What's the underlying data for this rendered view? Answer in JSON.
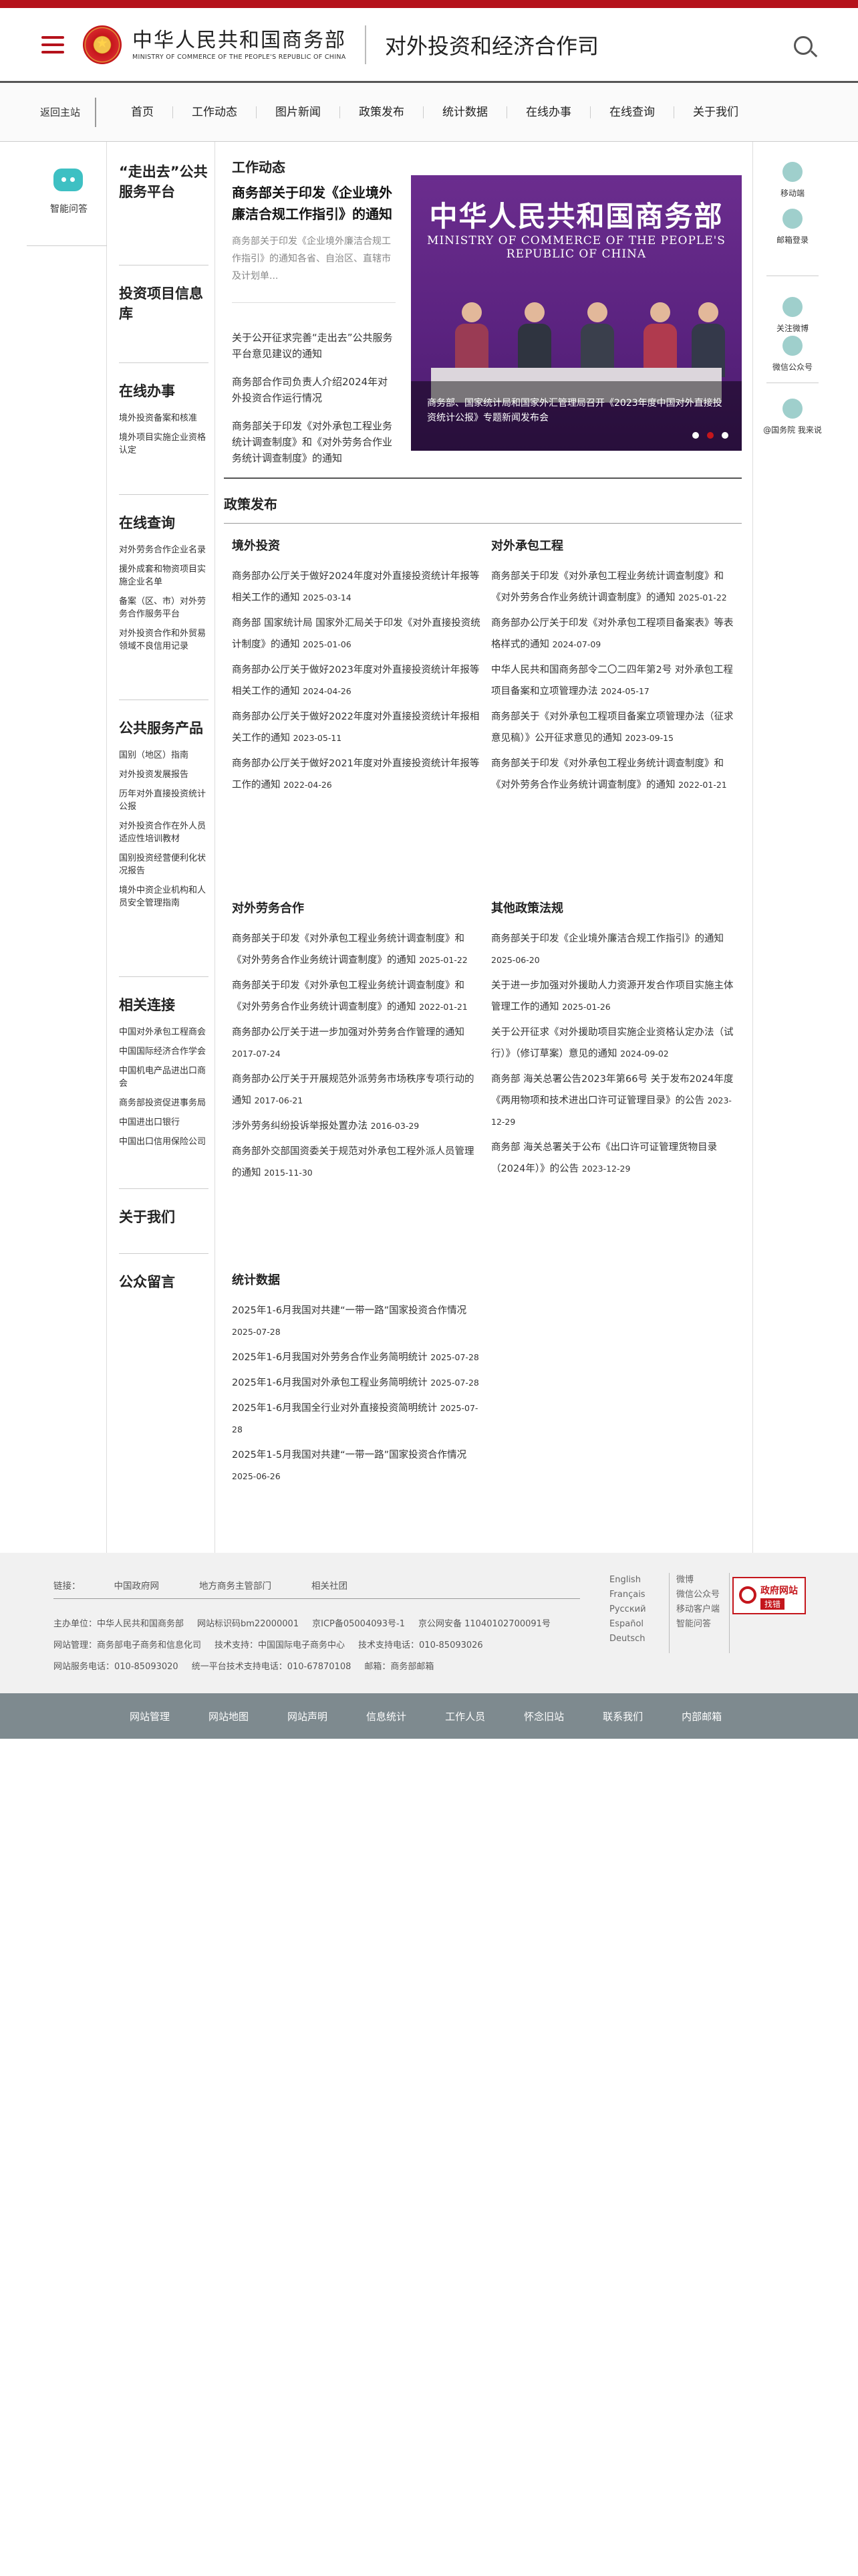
{
  "header": {
    "logo_cn": "中华人民共和国商务部",
    "logo_en": "MINISTRY OF COMMERCE OF THE PEOPLE'S REPUBLIC OF CHINA",
    "site_title": "对外投资和经济合作司"
  },
  "nav": {
    "back": "返回主站",
    "items": [
      "首页",
      "工作动态",
      "图片新闻",
      "政策发布",
      "统计数据",
      "在线办事",
      "在线查询",
      "关于我们"
    ]
  },
  "left": {
    "assistant": "智能问答"
  },
  "side": {
    "groups": [
      {
        "title": "“走出去”公共服务平台",
        "items": []
      },
      {
        "title": "投资项目信息库",
        "items": []
      },
      {
        "title": "在线办事",
        "items": [
          "境外投资备案和核准",
          "境外项目实施企业资格认定"
        ]
      },
      {
        "title": "在线查询",
        "items": [
          "对外劳务合作企业名录",
          "援外成套和物资项目实施企业名单",
          "备案（区、市）对外劳务合作服务平台",
          "对外投资合作和外贸易领域不良信用记录"
        ]
      },
      {
        "title": "公共服务产品",
        "items": [
          "国别（地区）指南",
          "对外投资发展报告",
          "历年对外直接投资统计公报",
          "对外投资合作在外人员适应性培训教材",
          "国别投资经营便利化状况报告",
          "境外中资企业机构和人员安全管理指南"
        ]
      },
      {
        "title": "相关连接",
        "items": [
          "中国对外承包工程商会",
          "中国国际经济合作学会",
          "中国机电产品进出口商会",
          "商务部投资促进事务局",
          "中国进出口银行",
          "中国出口信用保险公司"
        ]
      },
      {
        "title": "关于我们",
        "items": []
      },
      {
        "title": "公众留言",
        "items": []
      }
    ]
  },
  "news": {
    "section_title": "工作动态",
    "feature_title": "商务部关于印发《企业境外廉洁合规工作指引》的通知",
    "feature_desc": "商务部关于印发《企业境外廉洁合规工作指引》的通知各省、自治区、直辖市及计划单...",
    "list": [
      "关于公开征求完善“走出去”公共服务平台意见建议的通知",
      "商务部合作司负责人介绍2024年对外投资合作运行情况",
      "商务部关于印发《对外承包工程业务统计调查制度》和《对外劳务合作业务统计调查制度》的通知"
    ],
    "banner_cn": "中华人民共和国商务部",
    "banner_en": "MINISTRY OF COMMERCE OF THE PEOPLE'S REPUBLIC OF CHINA",
    "banner_caption": "商务部、国家统计局和国家外汇管理局召开《2023年度中国对外直接投资统计公报》专题新闻发布会"
  },
  "policy": {
    "title": "政策发布",
    "cols": [
      {
        "title": "境外投资",
        "items": [
          {
            "t": "商务部办公厅关于做好2024年度对外直接投资统计年报等相关工作的通知",
            "d": "2025-03-14"
          },
          {
            "t": "商务部 国家统计局 国家外汇局关于印发《对外直接投资统计制度》的通知",
            "d": "2025-01-06"
          },
          {
            "t": "商务部办公厅关于做好2023年度对外直接投资统计年报等相关工作的通知",
            "d": "2024-04-26"
          },
          {
            "t": "商务部办公厅关于做好2022年度对外直接投资统计年报相关工作的通知",
            "d": "2023-05-11"
          },
          {
            "t": "商务部办公厅关于做好2021年度对外直接投资统计年报等工作的通知",
            "d": "2022-04-26"
          }
        ]
      },
      {
        "title": "对外承包工程",
        "items": [
          {
            "t": "商务部关于印发《对外承包工程业务统计调查制度》和《对外劳务合作业务统计调查制度》的通知",
            "d": "2025-01-22"
          },
          {
            "t": "商务部办公厅关于印发《对外承包工程项目备案表》等表格样式的通知",
            "d": "2024-07-09"
          },
          {
            "t": "中华人民共和国商务部令二〇二四年第2号 对外承包工程项目备案和立项管理办法",
            "d": "2024-05-17"
          },
          {
            "t": "商务部关于《对外承包工程项目备案立项管理办法（征求意见稿）》公开征求意见的通知",
            "d": "2023-09-15"
          },
          {
            "t": "商务部关于印发《对外承包工程业务统计调查制度》和《对外劳务合作业务统计调查制度》的通知",
            "d": "2022-01-21"
          }
        ]
      },
      {
        "title": "对外劳务合作",
        "items": [
          {
            "t": "商务部关于印发《对外承包工程业务统计调查制度》和《对外劳务合作业务统计调查制度》的通知",
            "d": "2025-01-22"
          },
          {
            "t": "商务部关于印发《对外承包工程业务统计调查制度》和《对外劳务合作业务统计调查制度》的通知",
            "d": "2022-01-21"
          },
          {
            "t": "商务部办公厅关于进一步加强对外劳务合作管理的通知",
            "d": "2017-07-24"
          },
          {
            "t": "商务部办公厅关于开展规范外派劳务市场秩序专项行动的通知",
            "d": "2017-06-21"
          },
          {
            "t": "涉外劳务纠纷投诉举报处置办法",
            "d": "2016-03-29"
          },
          {
            "t": "商务部外交部国资委关于规范对外承包工程外派人员管理的通知",
            "d": "2015-11-30"
          }
        ]
      },
      {
        "title": "其他政策法规",
        "items": [
          {
            "t": "商务部关于印发《企业境外廉洁合规工作指引》的通知",
            "d": "2025-06-20"
          },
          {
            "t": "关于进一步加强对外援助人力资源开发合作项目实施主体管理工作的通知",
            "d": "2025-01-26"
          },
          {
            "t": "关于公开征求《对外援助项目实施企业资格认定办法（试行）》（修订草案）意见的通知",
            "d": "2024-09-02"
          },
          {
            "t": "商务部 海关总署公告2023年第66号 关于发布2024年度《两用物项和技术进出口许可证管理目录》的公告",
            "d": "2023-12-29"
          },
          {
            "t": "商务部 海关总署关于公布《出口许可证管理货物目录（2024年）》的公告",
            "d": "2023-12-29"
          }
        ]
      },
      {
        "title": "统计数据",
        "items": [
          {
            "t": "2025年1-6月我国对共建“一带一路”国家投资合作情况",
            "d": "2025-07-28"
          },
          {
            "t": "2025年1-6月我国对外劳务合作业务简明统计",
            "d": "2025-07-28"
          },
          {
            "t": "2025年1-6月我国对外承包工程业务简明统计",
            "d": "2025-07-28"
          },
          {
            "t": "2025年1-6月我国全行业对外直接投资简明统计",
            "d": "2025-07-28"
          },
          {
            "t": "2025年1-5月我国对共建“一带一路”国家投资合作情况",
            "d": "2025-06-26"
          }
        ]
      }
    ]
  },
  "right": {
    "items": [
      "移动端",
      "邮箱登录",
      "关注微博",
      "微信公众号",
      "@国务院 我来说"
    ]
  },
  "footer": {
    "links_label": "链接：",
    "links": [
      "中国政府网",
      "地方商务主管部门",
      "相关社团"
    ],
    "info": [
      [
        "主办单位：中华人民共和国商务部",
        "网站标识码bm22000001",
        "京ICP备05004093号-1",
        "京公网安备 11040102700091号"
      ],
      [
        "网站管理：商务部电子商务和信息化司",
        "技术支持：中国国际电子商务中心",
        "技术支持电话：010-85093026"
      ],
      [
        "网站服务电话：010-85093020",
        "统一平台技术支持电话：010-67870108",
        "邮箱：商务部邮箱"
      ]
    ],
    "langs": [
      "English",
      "Français",
      "Русский",
      "Español",
      "Deutsch"
    ],
    "social": [
      "微博",
      "微信公众号",
      "移动客户端",
      "智能问答"
    ],
    "badge_top": "政府网站",
    "badge_bottom": "找错"
  },
  "bottom_links": [
    "网站管理",
    "网站地图",
    "网站声明",
    "信息统计",
    "工作人员",
    "怀念旧站",
    "联系我们",
    "内部邮箱"
  ]
}
